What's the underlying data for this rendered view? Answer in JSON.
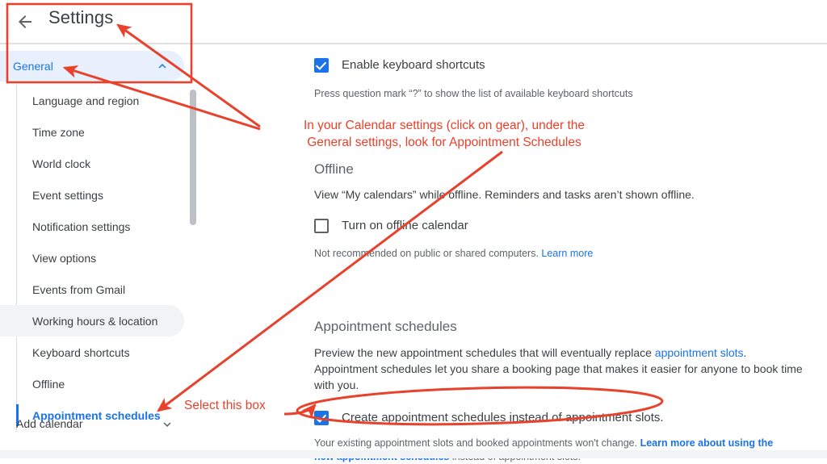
{
  "window": {
    "title": "Settings",
    "back_icon": "back-arrow-icon"
  },
  "sidebar": {
    "general": {
      "label": "General",
      "expand_icon": "chevron-up-icon"
    },
    "items": [
      {
        "label": "Language and region",
        "state": "default"
      },
      {
        "label": "Time zone",
        "state": "default"
      },
      {
        "label": "World clock",
        "state": "default"
      },
      {
        "label": "Event settings",
        "state": "default"
      },
      {
        "label": "Notification settings",
        "state": "default"
      },
      {
        "label": "View options",
        "state": "default"
      },
      {
        "label": "Events from Gmail",
        "state": "default"
      },
      {
        "label": "Working hours & location",
        "state": "hovered"
      },
      {
        "label": "Keyboard shortcuts",
        "state": "default"
      },
      {
        "label": "Offline",
        "state": "default"
      },
      {
        "label": "Appointment schedules",
        "state": "selected"
      }
    ],
    "footer": {
      "label": "Add calendar",
      "expand_icon": "chevron-down-icon"
    }
  },
  "main": {
    "keyboard": {
      "checkbox_label": "Enable keyboard shortcuts",
      "checked": true,
      "helper": "Press question mark “?” to show the list of available keyboard shortcuts"
    },
    "offline": {
      "title": "Offline",
      "description": "View “My calendars” while offline. Reminders and tasks aren’t shown offline.",
      "checkbox_label": "Turn on offline calendar",
      "checked": false,
      "helper_prefix": "Not recommended on public or shared computers. ",
      "helper_link": "Learn more"
    },
    "appointment": {
      "title": "Appointment schedules",
      "desc_part1": "Preview the new appointment schedules that will eventually replace ",
      "desc_link": "appointment slots",
      "desc_part2": ". Appointment schedules let you share a booking page that makes it easier for anyone to book time with you.",
      "checkbox_label": "Create appointment schedules instead of appointment slots.",
      "checked": true,
      "helper_prefix": "Your existing appointment slots and booked appointments won't change. ",
      "helper_link": "Learn more about using the new appointment schedules",
      "helper_suffix": " instead of appointment slots."
    }
  },
  "annotations": {
    "color": "#e8412c",
    "note_top_line1": "In your Calendar settings (click on gear), under the",
    "note_top_line2": "General settings, look for Appointment Schedules",
    "note_bottom": "Select this box"
  }
}
